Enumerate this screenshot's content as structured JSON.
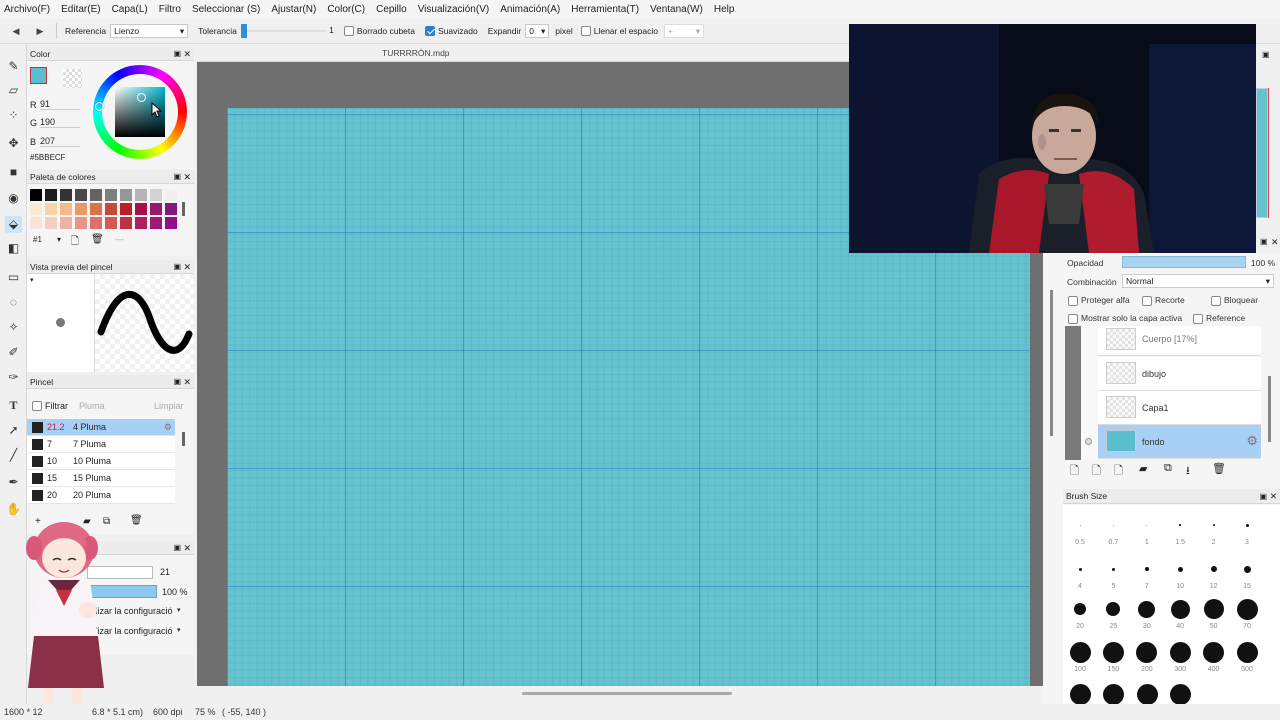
{
  "menu": [
    "Archivo(F)",
    "Editar(E)",
    "Capa(L)",
    "Filtro",
    "Seleccionar (S)",
    "Ajustar(N)",
    "Color(C)",
    "Cepillo",
    "Visualización(V)",
    "Animación(A)",
    "Herramienta(T)",
    "Ventana(W)",
    "Help"
  ],
  "toolbar": {
    "referencia_label": "Referencia",
    "referencia_value": "Lienzo",
    "tolerancia_label": "Tolerancia",
    "tolerancia_value": "1",
    "borrado_label": "Borrado cubeta",
    "suavizado_label": "Suavizado",
    "suavizado_checked": true,
    "expandir_label": "Expandir",
    "expandir_value": "0",
    "pixel_label": "pixel",
    "llenar_label": "Llenar el espacio"
  },
  "document": {
    "tab_title": "TURRRRÓN.mdp"
  },
  "color_panel": {
    "title": "Color",
    "current_color": "#5BBECF",
    "r_label": "R",
    "r": "91",
    "g_label": "G",
    "g": "190",
    "b_label": "B",
    "b": "207",
    "hex": "#5BBECF"
  },
  "palette_panel": {
    "title": "Paleta de colores",
    "index": "#1",
    "colors": [
      "#000000",
      "#1c1c1c",
      "#333333",
      "#4a4a4a",
      "#646464",
      "#7d7d7d",
      "#969696",
      "#b4b4b4",
      "#d2d2d2",
      "#f0f0f0",
      "#fde9cf",
      "#f9d2a8",
      "#f4b88a",
      "#e89a6a",
      "#d8734a",
      "#c44a3a",
      "#b8202a",
      "#a8104a",
      "#981870",
      "#801a80",
      "#fbe3dc",
      "#f7cdc2",
      "#f0b0a4",
      "#e89488",
      "#e07070",
      "#d45a5a",
      "#c03048",
      "#b02060",
      "#a0187a",
      "#90108c"
    ]
  },
  "brush_preview_panel": {
    "title": "Vista previa del pincel"
  },
  "brush_panel": {
    "title": "Pincel",
    "filter_label": "Filtrar",
    "filter_placeholder": "Pluma",
    "clear_label": "Limpiar",
    "items": [
      {
        "num": "21.2",
        "name": "4 Pluma",
        "selected": true
      },
      {
        "num": "7",
        "name": "7 Pluma",
        "selected": false
      },
      {
        "num": "10",
        "name": "10 Pluma",
        "selected": false
      },
      {
        "num": "15",
        "name": "15 Pluma",
        "selected": false
      },
      {
        "num": "20",
        "name": "20 Pluma",
        "selected": false
      }
    ]
  },
  "brush_settings": {
    "title_fragment": "es",
    "size_value": "21",
    "opacity_value": "100 %",
    "config1": "tilizar la configuració",
    "config2": "tilizar la configuració"
  },
  "layers_panel": {
    "opacity_label": "Opacidad",
    "opacity_value": "100 %",
    "blend_label": "Combinación",
    "blend_value": "Normal",
    "protect_alpha": "Proteger alfa",
    "clipping": "Recorte",
    "lock": "Bloquear",
    "show_active_only": "Mostrar solo la capa activa",
    "reference": "Reference",
    "layers": [
      {
        "name": "Cuerpo [17%]"
      },
      {
        "name": "dibujo"
      },
      {
        "name": "Capa1"
      },
      {
        "name": "fondo"
      }
    ]
  },
  "brush_size_panel": {
    "title": "Brush Size",
    "sizes": [
      "0.5",
      "0.7",
      "1",
      "1.5",
      "2",
      "3",
      "4",
      "5",
      "7",
      "10",
      "12",
      "15",
      "20",
      "25",
      "30",
      "40",
      "50",
      "70",
      "100",
      "150",
      "200",
      "300",
      "400",
      "500"
    ]
  },
  "status": {
    "dimensions": "1600 * 12",
    "cm": "6.8 * 5.1 cm)",
    "dpi": "600 dpi",
    "zoom": "75 %",
    "coords": "( -55, 140 )"
  }
}
